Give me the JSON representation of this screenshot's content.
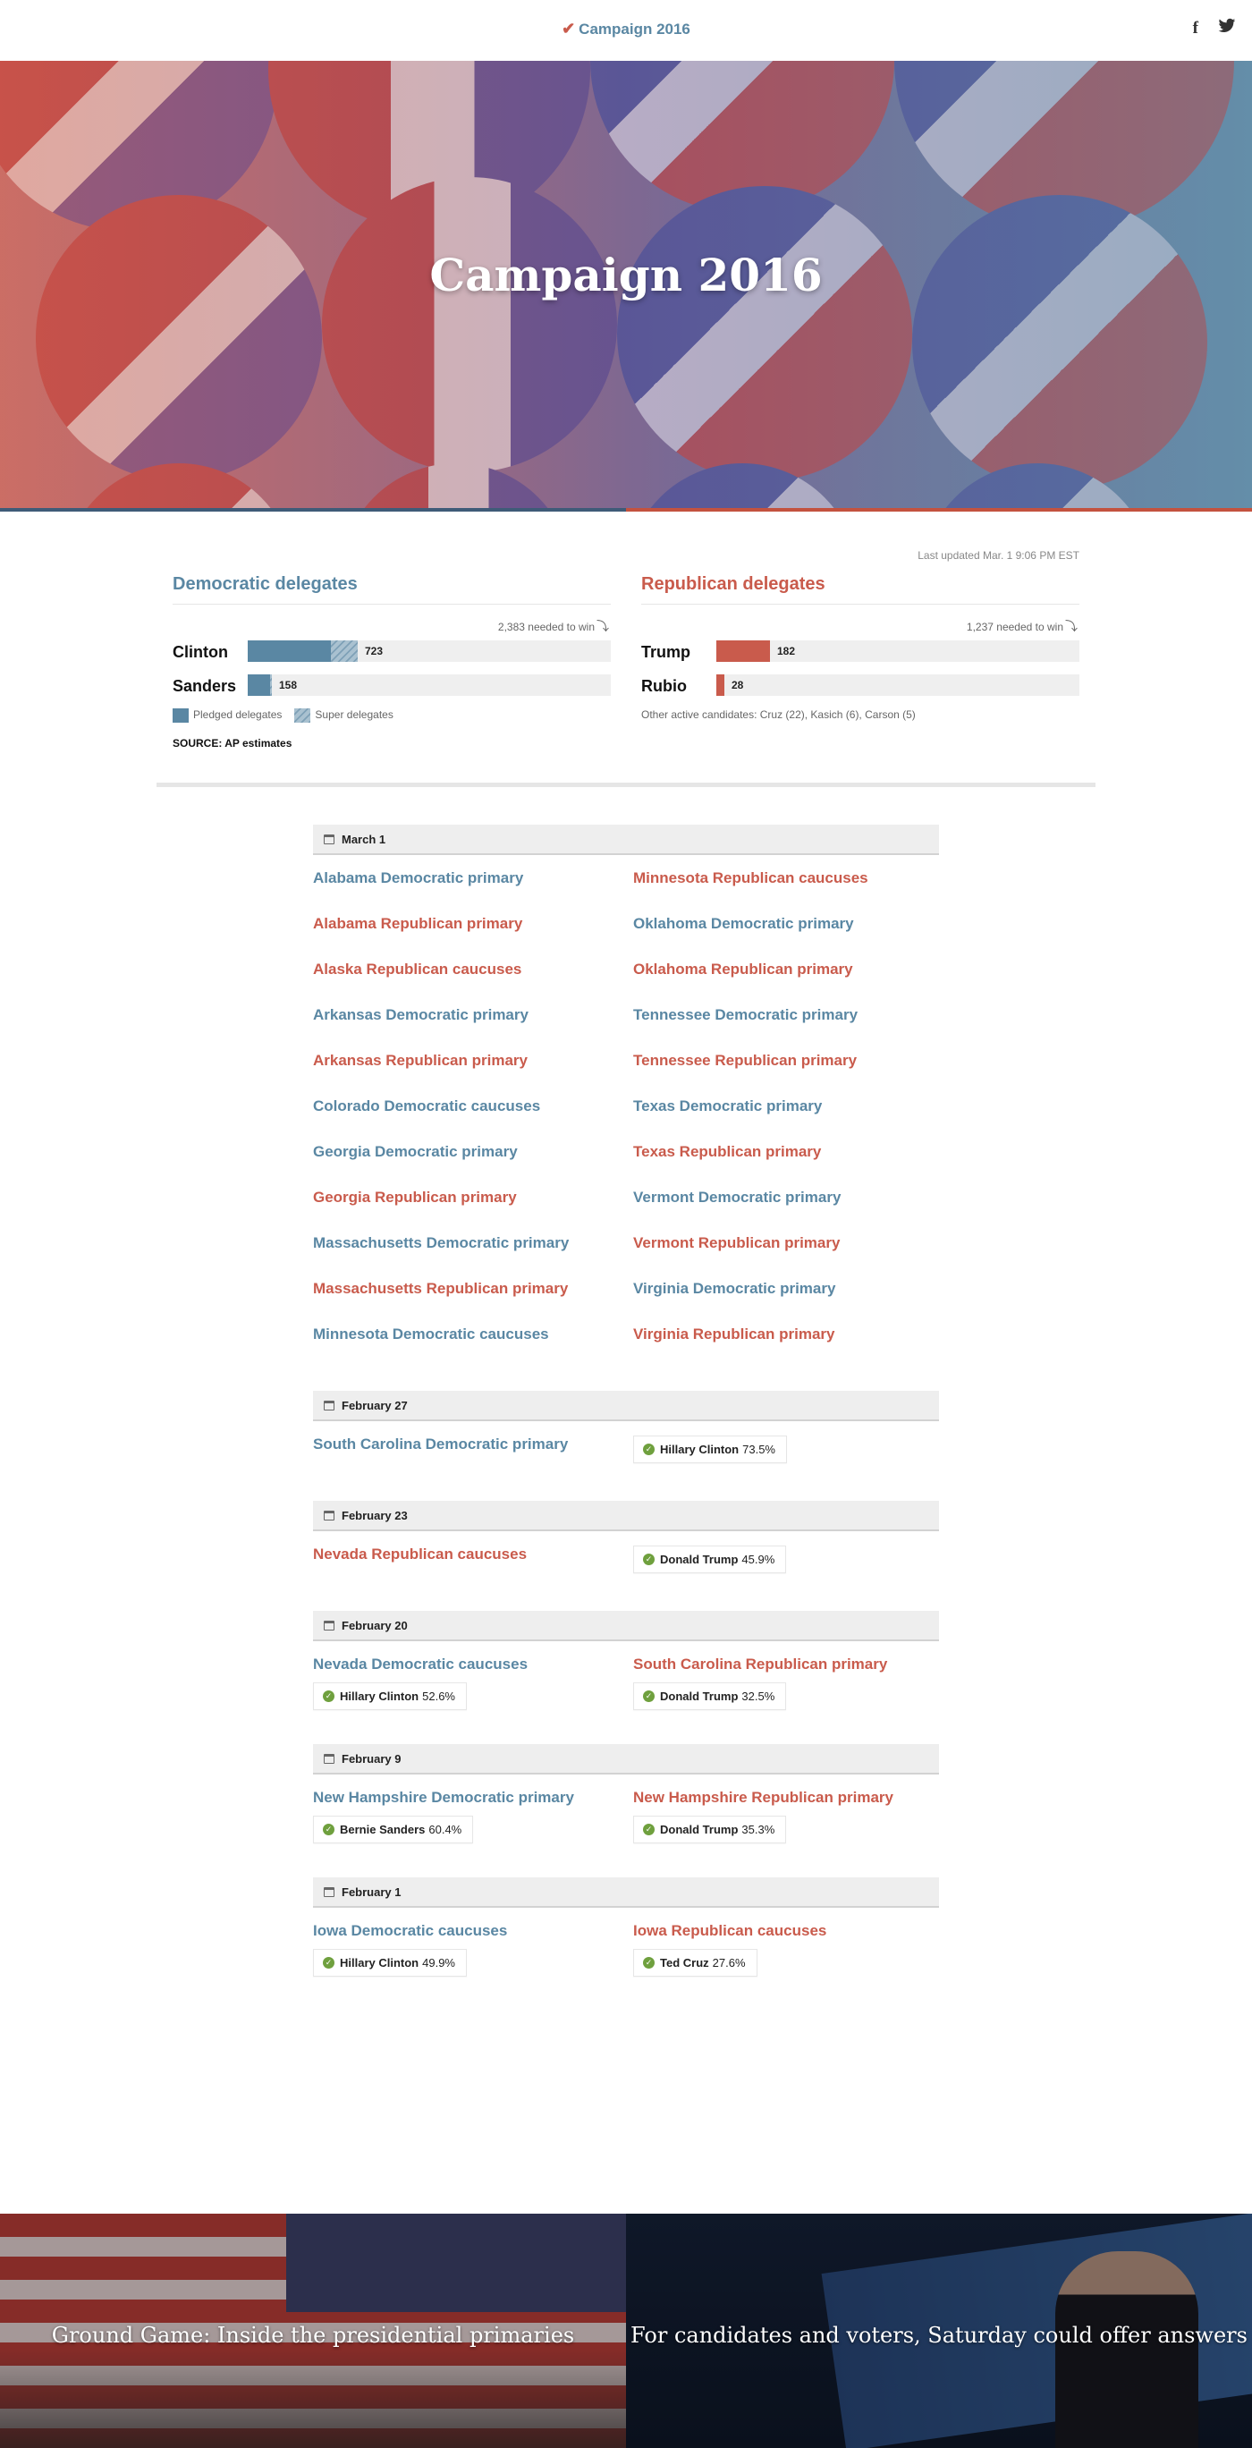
{
  "header": {
    "brand": "Campaign 2016",
    "facebook_label": "f"
  },
  "hero": {
    "title": "Campaign 2016"
  },
  "delegates": {
    "last_updated": "Last updated Mar. 1 9:06 PM EST",
    "democratic": {
      "title": "Democratic delegates",
      "needed": "2,383 needed to win",
      "scale_max": 2383,
      "candidates": [
        {
          "name": "Clinton",
          "pledged": 544,
          "super": 179,
          "total": "723"
        },
        {
          "name": "Sanders",
          "pledged": 146,
          "super": 12,
          "total": "158"
        }
      ],
      "legend": {
        "pledged": "Pledged delegates",
        "super": "Super delegates"
      },
      "source": "SOURCE: AP estimates"
    },
    "republican": {
      "title": "Republican delegates",
      "needed": "1,237 needed to win",
      "scale_max": 1237,
      "candidates": [
        {
          "name": "Trump",
          "pledged": 182,
          "total": "182"
        },
        {
          "name": "Rubio",
          "pledged": 28,
          "total": "28"
        }
      ],
      "other": "Other active candidates: Cruz (22), Kasich (6), Carson (5)"
    }
  },
  "days": [
    {
      "date": "March 1",
      "left": [
        {
          "party": "D",
          "title": "Alabama Democratic primary"
        },
        {
          "party": "R",
          "title": "Alabama Republican primary"
        },
        {
          "party": "R",
          "title": "Alaska Republican caucuses"
        },
        {
          "party": "D",
          "title": "Arkansas Democratic primary"
        },
        {
          "party": "R",
          "title": "Arkansas Republican primary"
        },
        {
          "party": "D",
          "title": "Colorado Democratic caucuses"
        },
        {
          "party": "D",
          "title": "Georgia Democratic primary"
        },
        {
          "party": "R",
          "title": "Georgia Republican primary"
        },
        {
          "party": "D",
          "title": "Massachusetts Democratic primary"
        },
        {
          "party": "R",
          "title": "Massachusetts Republican primary"
        },
        {
          "party": "D",
          "title": "Minnesota Democratic caucuses"
        }
      ],
      "right": [
        {
          "party": "R",
          "title": "Minnesota Republican caucuses"
        },
        {
          "party": "D",
          "title": "Oklahoma Democratic primary"
        },
        {
          "party": "R",
          "title": "Oklahoma Republican primary"
        },
        {
          "party": "D",
          "title": "Tennessee Democratic primary"
        },
        {
          "party": "R",
          "title": "Tennessee Republican primary"
        },
        {
          "party": "D",
          "title": "Texas Democratic primary"
        },
        {
          "party": "R",
          "title": "Texas Republican primary"
        },
        {
          "party": "D",
          "title": "Vermont Democratic primary"
        },
        {
          "party": "R",
          "title": "Vermont Republican primary"
        },
        {
          "party": "D",
          "title": "Virginia Democratic primary"
        },
        {
          "party": "R",
          "title": "Virginia Republican primary"
        }
      ]
    },
    {
      "date": "February 27",
      "side_winner": true,
      "left": [
        {
          "party": "D",
          "title": "South Carolina Democratic primary",
          "winner": "Hillary Clinton",
          "pct": "73.5%"
        }
      ],
      "right": []
    },
    {
      "date": "February 23",
      "side_winner": true,
      "left": [
        {
          "party": "R",
          "title": "Nevada Republican caucuses",
          "winner": "Donald Trump",
          "pct": "45.9%"
        }
      ],
      "right": []
    },
    {
      "date": "February 20",
      "left": [
        {
          "party": "D",
          "title": "Nevada Democratic caucuses",
          "winner": "Hillary Clinton",
          "pct": "52.6%"
        }
      ],
      "right": [
        {
          "party": "R",
          "title": "South Carolina Republican primary",
          "winner": "Donald Trump",
          "pct": "32.5%"
        }
      ]
    },
    {
      "date": "February 9",
      "left": [
        {
          "party": "D",
          "title": "New Hampshire Democratic primary",
          "winner": "Bernie Sanders",
          "pct": "60.4%"
        }
      ],
      "right": [
        {
          "party": "R",
          "title": "New Hampshire Republican primary",
          "winner": "Donald Trump",
          "pct": "35.3%"
        }
      ]
    },
    {
      "date": "February 1",
      "left": [
        {
          "party": "D",
          "title": "Iowa Democratic caucuses",
          "winner": "Hillary Clinton",
          "pct": "49.9%"
        }
      ],
      "right": [
        {
          "party": "R",
          "title": "Iowa Republican caucuses",
          "winner": "Ted Cruz",
          "pct": "27.6%"
        }
      ]
    }
  ],
  "promos": [
    {
      "caption": "Ground Game: Inside the presidential primaries"
    },
    {
      "caption": "For candidates and voters, Saturday could offer answers"
    }
  ]
}
